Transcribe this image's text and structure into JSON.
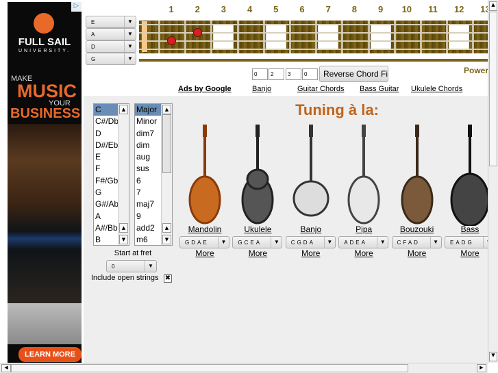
{
  "ad": {
    "brand": "FULL SAIL",
    "brand_sub": "UNIVERSITY.",
    "line1": "MAKE",
    "line2": "MUSIC",
    "line3": "YOUR",
    "line4": "BUSINESS",
    "cta": "LEARN MORE",
    "adchoices_icon": "adchoices-icon",
    "accent": "#e8692a"
  },
  "fretboard": {
    "fret_numbers": [
      "1",
      "2",
      "3",
      "4",
      "5",
      "6",
      "7",
      "8",
      "9",
      "10",
      "11",
      "12",
      "13"
    ],
    "strings": [
      "E",
      "A",
      "D",
      "G"
    ],
    "dots": [
      {
        "string": "D",
        "fret": 2
      },
      {
        "string": "A",
        "fret": 3
      }
    ]
  },
  "fingering": {
    "values": [
      "0",
      "2",
      "3",
      "0"
    ],
    "button": "Reverse Chord Fir",
    "powered": "Power"
  },
  "links": {
    "ads_by": "Ads by Google",
    "items": [
      "Banjo",
      "Guitar Chords",
      "Bass Guitar",
      "Ukulele Chords"
    ]
  },
  "roots": {
    "items": [
      "C",
      "C#/Db",
      "D",
      "D#/Eb",
      "E",
      "F",
      "F#/Gb",
      "G",
      "G#/Ab",
      "A",
      "A#/Bb",
      "B"
    ],
    "selected": "C"
  },
  "chords": {
    "items": [
      "Major",
      "Minor",
      "dim7",
      "dim",
      "aug",
      "sus",
      "6",
      "7",
      "maj7",
      "9",
      "add2",
      "m6"
    ],
    "selected": "Major"
  },
  "start_fret": {
    "label": "Start at fret",
    "value": "0"
  },
  "open_strings": {
    "label": "Include open strings",
    "checked": true
  },
  "tuning": {
    "title": "Tuning à la:",
    "title_color": "#c0631a",
    "instruments": [
      {
        "name": "Mandolin",
        "tuning": "GDAE",
        "more": "More"
      },
      {
        "name": "Ukulele",
        "tuning": "GCEA",
        "more": "More"
      },
      {
        "name": "Banjo",
        "tuning": "CGDA",
        "more": "More"
      },
      {
        "name": "Pipa",
        "tuning": "ADEA",
        "more": "More"
      },
      {
        "name": "Bouzouki",
        "tuning": "CFAD",
        "more": "More"
      },
      {
        "name": "Bass",
        "tuning": "EADG",
        "more": "More"
      }
    ]
  }
}
